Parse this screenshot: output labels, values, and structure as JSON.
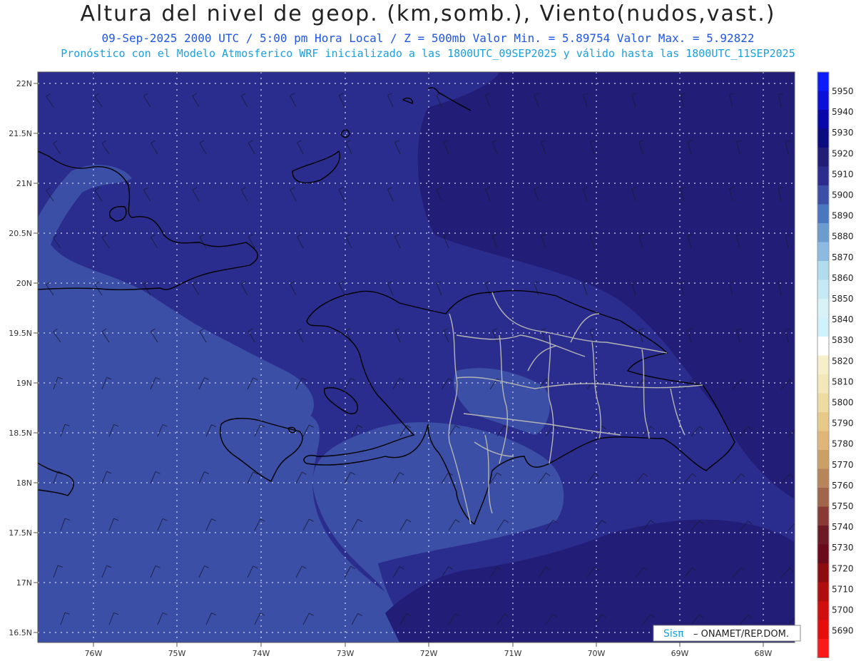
{
  "header": {
    "title": "Altura del nivel de geop. (km,somb.), Viento(nudos,vast.)",
    "line1": "09-Sep-2025  2000 UTC / 5:00 pm Hora Local / Z = 500mb    Valor Min. = 5.89754  Valor Max. = 5.92822",
    "line2": "Pronóstico con el Modelo Atmosferico WRF inicializado a las 1800UTC_09SEP2025 y válido hasta las  1800UTC_11SEP2025"
  },
  "map": {
    "lat_labels": [
      "22N",
      "21.5N",
      "21N",
      "20.5N",
      "20N",
      "19.5N",
      "19N",
      "18.5N",
      "18N",
      "17.5N",
      "17N",
      "16.5N"
    ],
    "lon_labels": [
      "76W",
      "75W",
      "74W",
      "73W",
      "72W",
      "71W",
      "70W",
      "69W",
      "68W"
    ],
    "colors": {
      "level_5900": "#3a4fa5",
      "level_5910": "#2b2d8e",
      "level_5920": "#221e78",
      "coast": "#000000",
      "provinces": "#b4b4b4",
      "grid": "#d8d8f0"
    },
    "credit_brand": "Sisπ",
    "credit_text": "– ONAMET/REP.DOM."
  },
  "legend": {
    "colors": [
      "#0a1cfa",
      "#0a10d8",
      "#0808a8",
      "#0c0c82",
      "#221e78",
      "#2b2d8e",
      "#3a4fa5",
      "#4977c0",
      "#6a9cd0",
      "#8cbbe2",
      "#b0dcee",
      "#c6eaf5",
      "#d8f2f8",
      "#d0f2fb",
      "#ffffff",
      "#f7efc9",
      "#f3e6b8",
      "#eedba2",
      "#e8c98a",
      "#dfb578",
      "#caa066",
      "#b8855a",
      "#a0654a",
      "#8a3a35",
      "#6d1a24",
      "#6b0a18",
      "#8e0c10",
      "#b00d0d",
      "#d00e0e",
      "#e60d0d",
      "#fb1a1a"
    ],
    "labels": [
      "5950",
      "5940",
      "5930",
      "5920",
      "5910",
      "5900",
      "5890",
      "5880",
      "5870",
      "5860",
      "5850",
      "5840",
      "5830",
      "5820",
      "5810",
      "5800",
      "5790",
      "5780",
      "5770",
      "5760",
      "5750",
      "5740",
      "5730",
      "5720",
      "5710",
      "5700",
      "5690"
    ]
  }
}
